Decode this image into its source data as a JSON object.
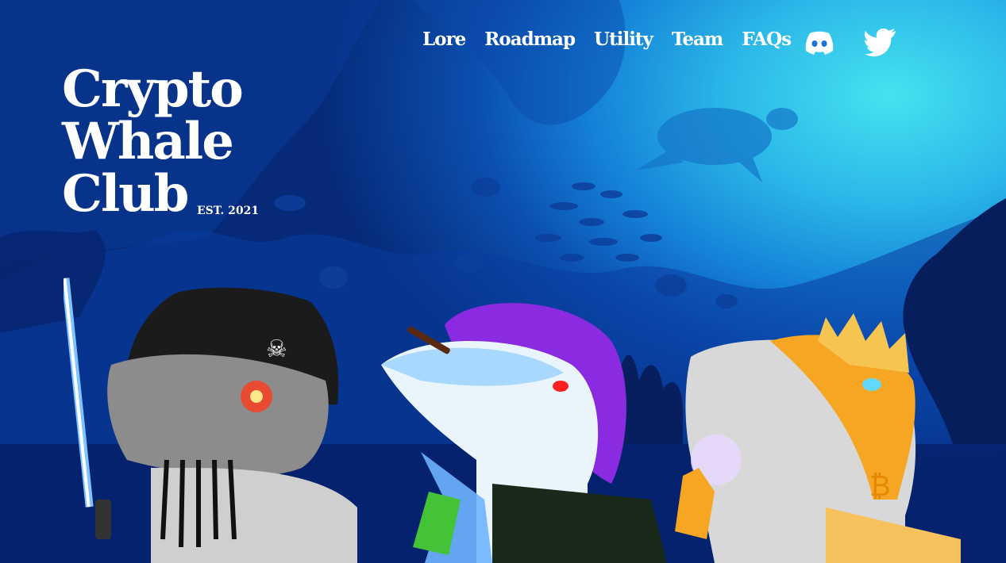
{
  "nav": {
    "items": [
      {
        "label": "Lore"
      },
      {
        "label": "Roadmap"
      },
      {
        "label": "Utility"
      },
      {
        "label": "Team"
      },
      {
        "label": "FAQs"
      }
    ],
    "social": [
      {
        "icon": "discord-icon"
      },
      {
        "icon": "twitter-icon"
      }
    ]
  },
  "logo": {
    "line1": "Crypto",
    "line2": "Whale",
    "line3": "Club",
    "est": "EST. 2021"
  },
  "colors": {
    "ocean_deep": "#062a78",
    "ocean_light": "#46e2f0",
    "silhouette": "#0a2a86",
    "mohawk": "#8a2be2",
    "gold_whale": "#f6a623",
    "text": "#ffffff"
  }
}
